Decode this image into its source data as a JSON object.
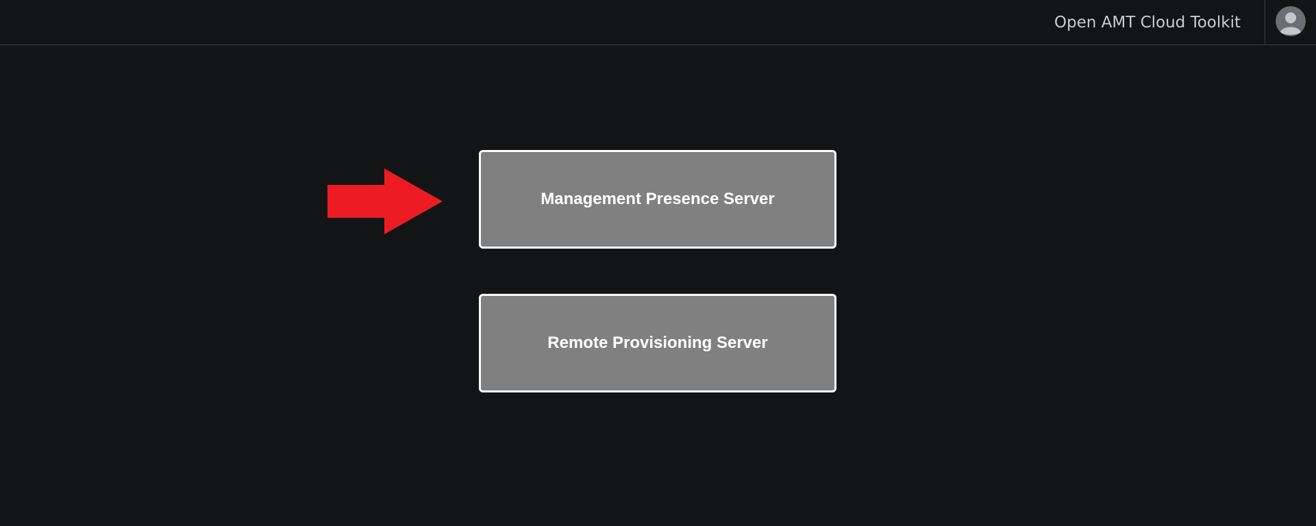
{
  "header": {
    "app_title": "Open AMT Cloud Toolkit",
    "avatar_icon": "user-avatar-icon"
  },
  "main": {
    "tiles": [
      {
        "label": "Management Presence Server"
      },
      {
        "label": "Remote Provisioning Server"
      }
    ],
    "annotation": {
      "icon": "red-arrow-icon",
      "color": "#ed1c24"
    }
  },
  "colors": {
    "background": "#131416",
    "tile_fill": "#808080",
    "tile_border": "#ffffff",
    "header_text": "#c9ccd1"
  }
}
